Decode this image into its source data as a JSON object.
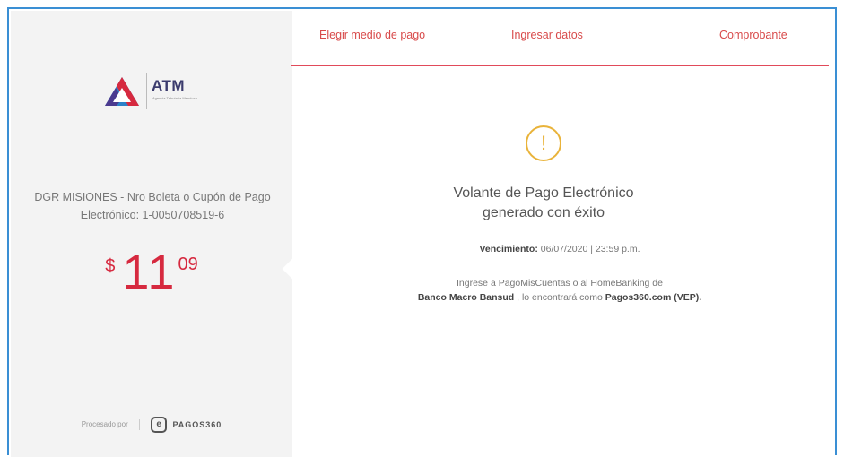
{
  "brand": {
    "name": "ATM",
    "subtitle": "Agencia Tributaria Mendoza"
  },
  "payment": {
    "description": "DGR MISIONES - Nro Boleta o Cupón de Pago Electrónico: 1-0050708519-6",
    "currency": "$",
    "amount_integer": "11",
    "amount_decimal": "09"
  },
  "processor": {
    "label": "Procesado por",
    "name": "PAGOS360",
    "icon_glyph": "e"
  },
  "tabs": [
    {
      "label": "Elegir medio de pago"
    },
    {
      "label": "Ingresar datos"
    },
    {
      "label": "Comprobante"
    }
  ],
  "result": {
    "icon": "alert-circle-icon",
    "icon_glyph": "!",
    "message": "Volante de Pago Electrónico generado con éxito",
    "due_label": "Vencimiento:",
    "due_value": "06/07/2020 | 23:59 p.m.",
    "instruction_line1": "Ingrese a PagoMisCuentas o al HomeBanking de",
    "bank": "Banco Macro Bansud",
    "instruction_mid": ", lo encontrará como",
    "vep": "Pagos360.com (VEP)."
  },
  "colors": {
    "accent": "#d6293f",
    "tab_text": "#d84a4a",
    "warning": "#e9b33a",
    "frame_border": "#3a8fd4"
  }
}
